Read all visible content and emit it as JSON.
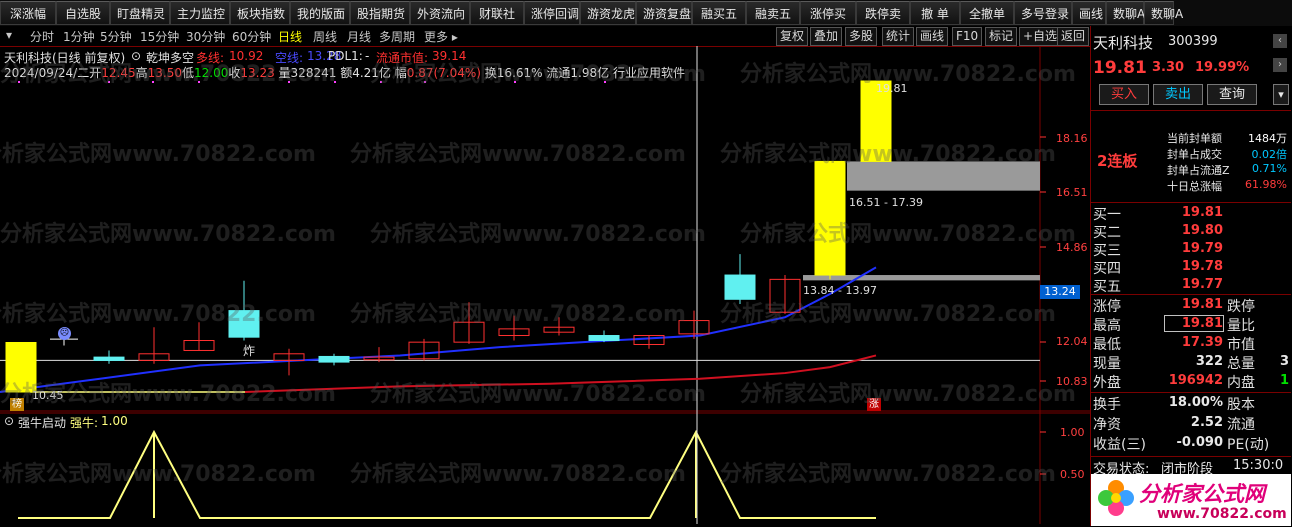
{
  "toolbar": {
    "buttons": [
      "深涨幅",
      "自选股",
      "盯盘精灵",
      "主力监控",
      "板块指数",
      "我的版面",
      "股指期货",
      "外资流向",
      "财联社",
      "涨停回调",
      "游资龙虎",
      "游资复盘",
      "融买五",
      "融卖五",
      "涨停买",
      "跌停卖",
      "撤 单",
      "全撤单",
      "多号登录",
      "画线",
      "数聊A",
      "数聊A"
    ]
  },
  "periods": {
    "items": [
      "分时",
      "1分钟",
      "5分钟",
      "15分钟",
      "30分钟",
      "60分钟",
      "日线",
      "周线",
      "月线",
      "多周期",
      "更多 ▸"
    ],
    "active": "日线"
  },
  "chart_tools": [
    "复权",
    "叠加",
    "多股",
    "统计",
    "画线",
    "F10",
    "标记",
    "+自选",
    "返回"
  ],
  "main_chart": {
    "title": "天利科技(日线 前复权)",
    "indicator_name": "乾坤多空",
    "legend": [
      {
        "label": "多线:",
        "value": "10.92",
        "color": "#ff3030"
      },
      {
        "label": "空线:",
        "value": "13.28",
        "color": "#2020ff"
      },
      {
        "label": "PDL1:",
        "value": "-",
        "color": "#e0e0e0"
      },
      {
        "label": "流通市值:",
        "value": "39.14",
        "color": "#ff3030"
      }
    ],
    "info_line": {
      "date": "2024/09/24/二",
      "open_label": "开",
      "open": "12.45",
      "high_label": "高",
      "high": "13.50",
      "low_label": "低",
      "low": "12.00",
      "close_label": "收",
      "close": "13.23",
      "vol": "量328241",
      "amount": "额4.21亿",
      "change_label": "幅",
      "change": "0.87(7.04%)",
      "turnover": "换16.61%",
      "float": "流通1.98亿",
      "industry": "行业应用软件"
    },
    "y_axis": [
      "18.16",
      "16.51",
      "14.86",
      "13.24",
      "12.04",
      "10.83"
    ],
    "current_price_tag": "13.24",
    "annotations": {
      "high_last": "19.81",
      "gap_upper": "16.51 - 17.39",
      "gap_lower": "13.84 - 13.97",
      "low_mark": "10.45",
      "cross_label": "炸",
      "limit_badge": "涨",
      "bottom_badge": "榜"
    }
  },
  "sub_chart": {
    "indicator_name": "强牛启动",
    "legend_label": "强牛:",
    "legend_value": "1.00",
    "y_axis": [
      "1.00",
      "0.50"
    ]
  },
  "watermark": "分析家公式网www.70822.com",
  "right_panel": {
    "stock_name": "天利科技",
    "stock_code": "300399",
    "price": "19.81",
    "change": "3.30",
    "change_pct": "19.99%",
    "buttons": [
      "买入",
      "卖出",
      "查询"
    ],
    "streak": "2连板",
    "seal_info": [
      {
        "label": "当前封单额",
        "value": "1484万",
        "color": "#ffffff"
      },
      {
        "label": "封单占成交",
        "value": "0.02倍",
        "color": "#00c8ff"
      },
      {
        "label": "封单占流通Z",
        "value": "0.71%",
        "color": "#00c8ff"
      },
      {
        "label": "十日总涨幅",
        "value": "61.98%",
        "color": "#ff3c3c"
      }
    ],
    "bids": [
      {
        "label": "买一",
        "price": "19.81"
      },
      {
        "label": "买二",
        "price": "19.80"
      },
      {
        "label": "买三",
        "price": "19.79"
      },
      {
        "label": "买四",
        "price": "19.78"
      },
      {
        "label": "买五",
        "price": "19.77"
      }
    ],
    "quote": [
      {
        "l1": "涨停",
        "v1": "19.81",
        "c1": "#ff3c3c",
        "l2": "跌停",
        "v2": ""
      },
      {
        "l1": "最高",
        "v1": "19.81",
        "c1": "#ff3c3c",
        "l2": "量比",
        "v2": ""
      },
      {
        "l1": "最低",
        "v1": "17.39",
        "c1": "#ff3c3c",
        "l2": "市值",
        "v2": ""
      },
      {
        "l1": "现量",
        "v1": "322",
        "c1": "#e8e8e8",
        "l2": "总量",
        "v2": "3"
      },
      {
        "l1": "外盘",
        "v1": "196942",
        "c1": "#ff3c3c",
        "l2": "内盘",
        "v2": "1"
      }
    ],
    "stats": [
      {
        "l1": "换手",
        "v1": "18.00%",
        "l2": "股本"
      },
      {
        "l1": "净资",
        "v1": "2.52",
        "l2": "流通"
      },
      {
        "l1": "收益(三)",
        "v1": "-0.090",
        "l2": "PE(动)"
      }
    ],
    "status_label": "交易状态:",
    "status_value": "闭市阶段",
    "status_time": "15:30:0",
    "logo_text": "分析家公式网",
    "logo_url": "www.70822.com"
  }
}
